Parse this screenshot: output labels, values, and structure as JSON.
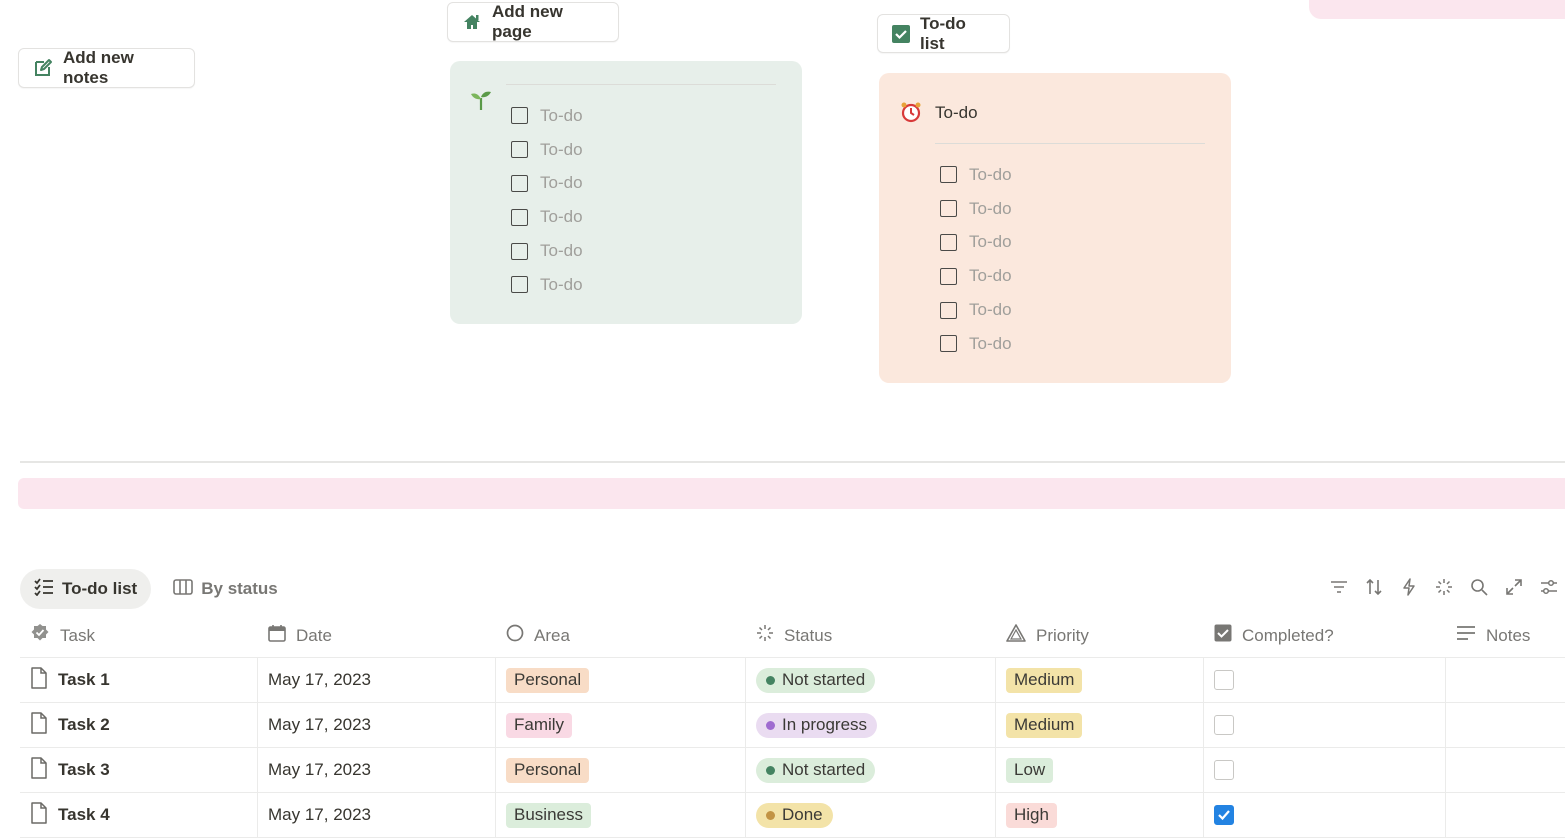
{
  "buttons": {
    "add_notes": "Add new notes",
    "add_page": "Add new page",
    "todo_list": "To-do list"
  },
  "green_card": {
    "items": [
      "To-do",
      "To-do",
      "To-do",
      "To-do",
      "To-do",
      "To-do"
    ]
  },
  "peach_card": {
    "title": "To-do",
    "items": [
      "To-do",
      "To-do",
      "To-do",
      "To-do",
      "To-do",
      "To-do"
    ]
  },
  "colors": {
    "green_card_bg": "#e7efea",
    "peach_card_bg": "#fbe8dd",
    "pink_banner": "#fbe6ee",
    "checkbox_blue": "#2383e2"
  },
  "tabs": [
    {
      "label": "To-do list",
      "icon": "checklist-icon",
      "active": true
    },
    {
      "label": "By status",
      "icon": "board-icon",
      "active": false
    }
  ],
  "columns": [
    "Task",
    "Date",
    "Area",
    "Status",
    "Priority",
    "Completed?",
    "Notes"
  ],
  "rows": [
    {
      "task": "Task 1",
      "date": "May 17, 2023",
      "area": "Personal",
      "status": "Not started",
      "priority": "Medium",
      "completed": false
    },
    {
      "task": "Task 2",
      "date": "May 17, 2023",
      "area": "Family",
      "status": "In progress",
      "priority": "Medium",
      "completed": false
    },
    {
      "task": "Task 3",
      "date": "May 17, 2023",
      "area": "Personal",
      "status": "Not started",
      "priority": "Low",
      "completed": false
    },
    {
      "task": "Task 4",
      "date": "May 17, 2023",
      "area": "Business",
      "status": "Done",
      "priority": "High",
      "completed": true
    }
  ]
}
